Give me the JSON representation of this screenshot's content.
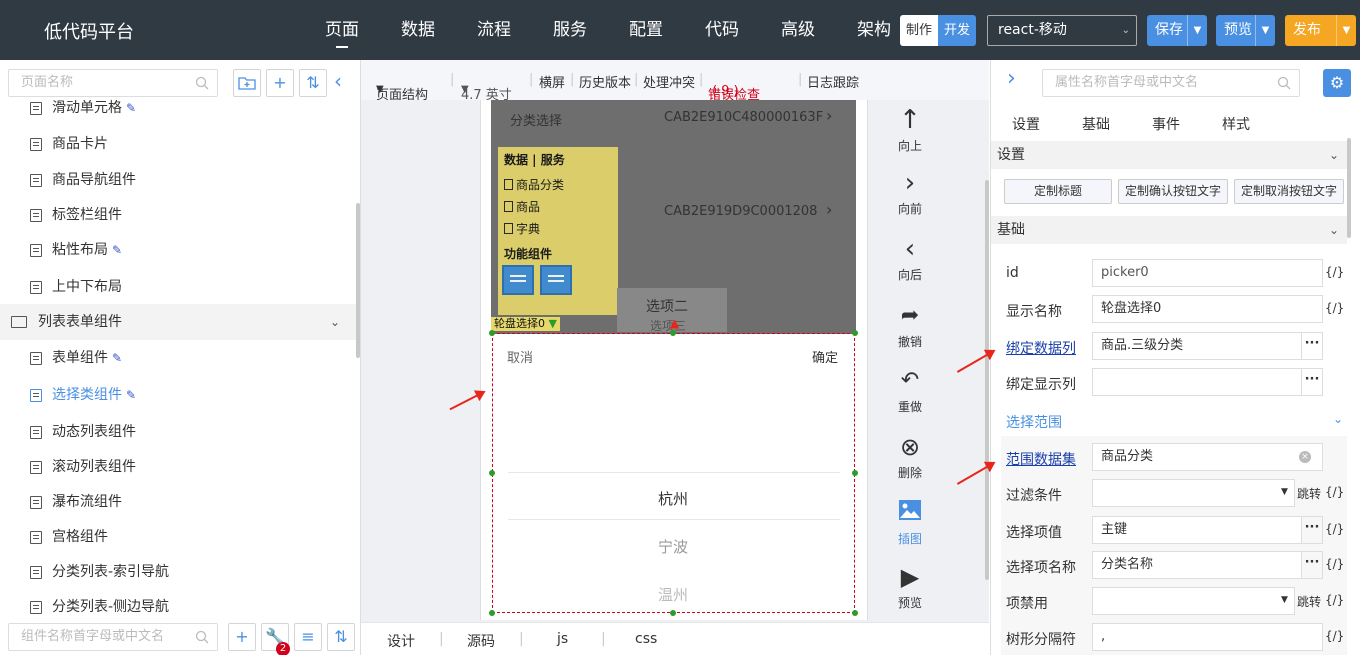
{
  "app": {
    "brand": "低代码平台"
  },
  "topnav": [
    "页面",
    "数据",
    "流程",
    "服务",
    "配置",
    "代码",
    "高级",
    "架构"
  ],
  "mode_toggle": {
    "make": "制作",
    "dev": "开发"
  },
  "env_select": "react-移动",
  "actions": {
    "save": "保存",
    "preview": "预览",
    "publish": "发布"
  },
  "left": {
    "search_placeholder": "页面名称",
    "bottom_search_placeholder": "组件名称首字母或中文名",
    "badge": "2",
    "tree": [
      {
        "label": "滑动单元格",
        "edit": true
      },
      {
        "label": "商品卡片",
        "edit": false
      },
      {
        "label": "商品导航组件",
        "edit": false
      },
      {
        "label": "标签栏组件",
        "edit": false
      },
      {
        "label": "粘性布局",
        "edit": true
      },
      {
        "label": "上中下布局",
        "edit": false
      },
      {
        "label": "列表表单组件",
        "group": true
      },
      {
        "label": "表单组件",
        "edit": true
      },
      {
        "label": "选择类组件",
        "edit": true,
        "selected": true
      },
      {
        "label": "动态列表组件",
        "edit": false
      },
      {
        "label": "滚动列表组件",
        "edit": false
      },
      {
        "label": "瀑布流组件",
        "edit": false
      },
      {
        "label": "宫格组件",
        "edit": false
      },
      {
        "label": "分类列表-索引导航",
        "edit": false
      },
      {
        "label": "分类列表-侧边导航",
        "edit": false
      }
    ]
  },
  "toolbar": {
    "structure": "页面结构",
    "size": "4.7 英寸",
    "landscape": "横屏",
    "history": "历史版本",
    "conflict": "处理冲突",
    "error": "错误检查",
    "error_count": "( 9 )",
    "log": "日志跟踪"
  },
  "canvas": {
    "row1_label": "分类选择",
    "row1_value": "CAB2E910C480000163F",
    "row2_value": "CAB2E919D9C0001208",
    "panel_header": "数据 | 服务",
    "panel_items": [
      "商品分类",
      "商品",
      "字典"
    ],
    "panel_func": "功能组件",
    "option2": "选项二",
    "option3": "选项三",
    "comp_tag": "轮盘选择0",
    "picker_cancel": "取消",
    "picker_confirm": "确定",
    "picker_items": [
      "杭州",
      "宁波",
      "温州"
    ]
  },
  "side_actions": [
    "向上",
    "向前",
    "向后",
    "撤销",
    "重做",
    "删除",
    "插图",
    "预览"
  ],
  "bottom_tabs": [
    "设计",
    "源码",
    "js",
    "css"
  ],
  "right": {
    "search_placeholder": "属性名称首字母或中文名",
    "tabs": [
      "设置",
      "基础",
      "事件",
      "样式"
    ],
    "section_settings": "设置",
    "custom_buttons": [
      "定制标题",
      "定制确认按钮文字",
      "定制取消按钮文字"
    ],
    "section_basic": "基础",
    "section_range": "选择范围",
    "code_icon": "{/}",
    "jump": "跳转",
    "props": {
      "id_label": "id",
      "id_value": "picker0",
      "name_label": "显示名称",
      "name_value": "轮盘选择0",
      "bind_col_label": "绑定数据列",
      "bind_col_value": "商品.三级分类",
      "bind_show_label": "绑定显示列",
      "bind_show_value": "",
      "range_ds_label": "范围数据集",
      "range_ds_value": "商品分类",
      "filter_label": "过滤条件",
      "filter_value": "",
      "opt_val_label": "选择项值",
      "opt_val_value": "主键",
      "opt_name_label": "选择项名称",
      "opt_name_value": "分类名称",
      "disable_label": "项禁用",
      "disable_value": "",
      "tree_sep_label": "树形分隔符",
      "tree_sep_value": ","
    }
  },
  "colors": {
    "topbar": "#2f3a43",
    "primary": "#4a90e2",
    "publish": "#f5a623",
    "error": "#d0021b",
    "annotation": "#e8261b"
  }
}
